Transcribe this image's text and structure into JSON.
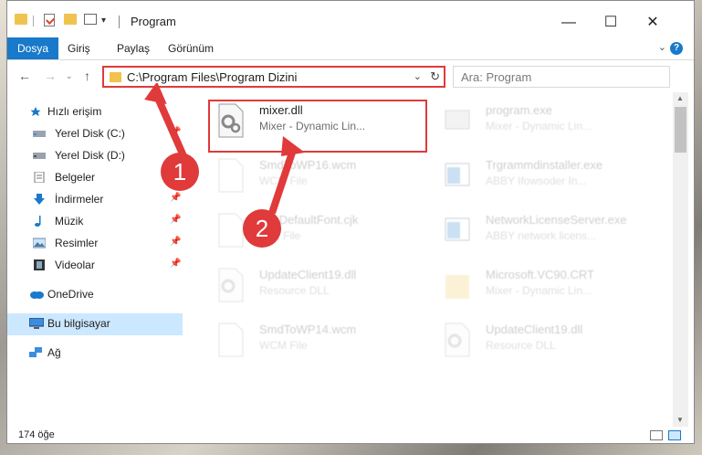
{
  "window": {
    "title": "Program"
  },
  "ribbon": {
    "file": "Dosya",
    "home": "Giriş",
    "share": "Paylaş",
    "view": "Görünüm",
    "help": "?"
  },
  "nav": {
    "address": "C:\\Program Files\\Program Dizini",
    "search_placeholder": "Ara: Program"
  },
  "sidebar": {
    "quick_access": "Hızlı erişim",
    "items": [
      {
        "label": "Yerel Disk (C:)",
        "pinned": true
      },
      {
        "label": "Yerel Disk (D:)",
        "pinned": false
      },
      {
        "label": "Belgeler",
        "pinned": false
      },
      {
        "label": "İndirmeler",
        "pinned": true
      },
      {
        "label": "Müzik",
        "pinned": true
      },
      {
        "label": "Resimler",
        "pinned": true
      },
      {
        "label": "Videolar",
        "pinned": true
      }
    ],
    "onedrive": "OneDrive",
    "this_pc": "Bu bilgisayar",
    "network": "Ağ"
  },
  "files": [
    {
      "name": "mixer.dll",
      "desc": "Mixer - Dynamic Lin...",
      "icon": "dll-gear-icon"
    },
    {
      "name": "program.exe",
      "desc": "Mixer - Dynamic Lin...",
      "icon": "exe-icon"
    },
    {
      "name": "SmdToWP16.wcm",
      "desc": "WCM File",
      "icon": "blank-file-icon"
    },
    {
      "name": "Trgrammdinstaller.exe",
      "desc": "ABBY Ifowsoder In...",
      "icon": "window-exe-icon"
    },
    {
      "name": "SysDefaultFont.cjk",
      "desc": "CJK File",
      "icon": "blank-file-icon"
    },
    {
      "name": "NetworkLicenseServer.exe",
      "desc": "ABBY network licens...",
      "icon": "window-exe-icon"
    },
    {
      "name": "UpdateClient19.dll",
      "desc": "Resource DLL",
      "icon": "dll-gear-icon"
    },
    {
      "name": "Microsoft.VC90.CRT",
      "desc": "Mixer - Dynamic Lin...",
      "icon": "folder-icon"
    },
    {
      "name": "SmdToWP14.wcm",
      "desc": "WCM File",
      "icon": "blank-file-icon"
    },
    {
      "name": "UpdateClient19.dll",
      "desc": "Resource DLL",
      "icon": "dll-gear-icon"
    }
  ],
  "annotations": {
    "step1": "1",
    "step2": "2"
  },
  "status": {
    "count": "174 öğe"
  },
  "colors": {
    "accent": "#1979ca",
    "highlight": "#e03a3a",
    "selected": "#cce8ff"
  }
}
